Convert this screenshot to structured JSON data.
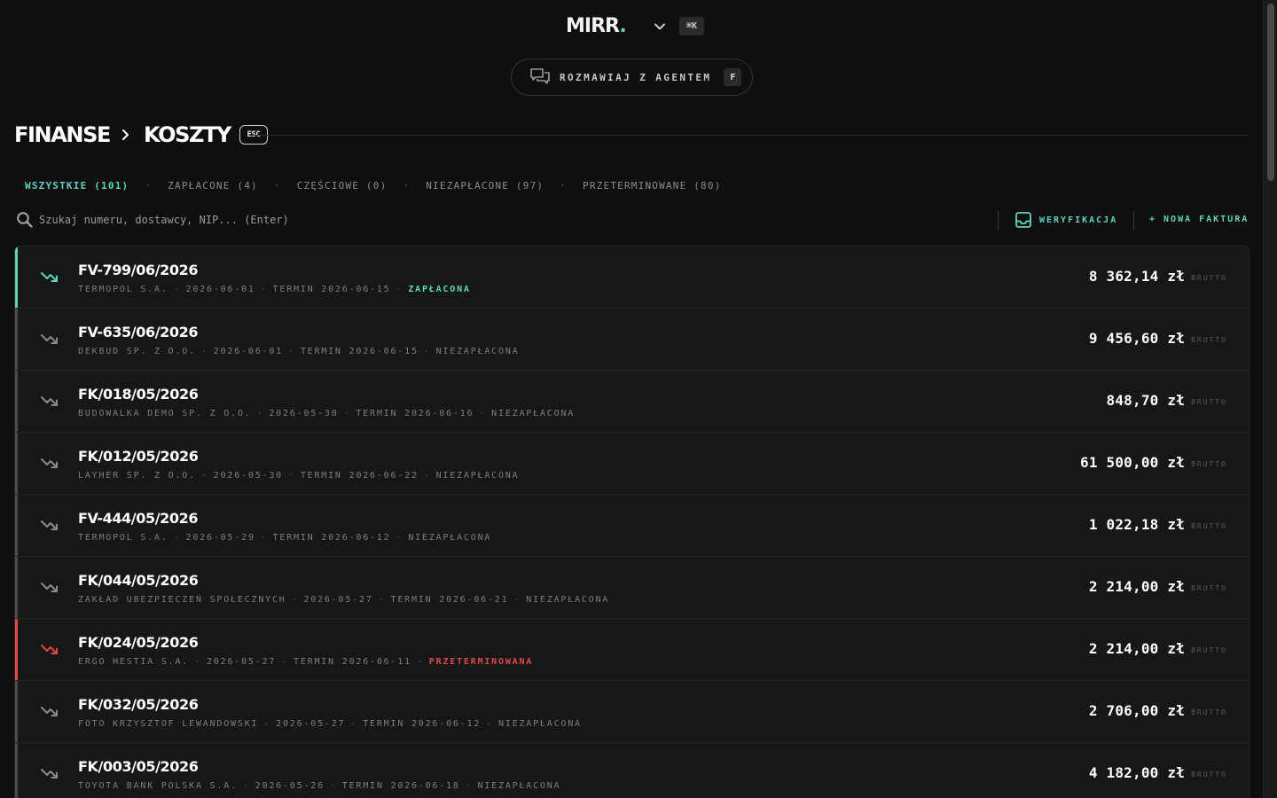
{
  "header": {
    "logo": "MIRR",
    "logo_dot": ".",
    "shortcut": "⌘K",
    "agent_label": "ROZMAWIAJ Z AGENTEM",
    "agent_shortcut": "F"
  },
  "breadcrumb": {
    "parent": "FINANSE",
    "current": "KOSZTY",
    "esc": "ESC"
  },
  "tabs": [
    {
      "label": "WSZYSTKIE (101)",
      "active": true
    },
    {
      "label": "ZAPŁACONE (4)"
    },
    {
      "label": "CZĘŚCIOWE (0)"
    },
    {
      "label": "NIEZAPŁACONE (97)"
    },
    {
      "label": "PRZETERMINOWANE (80)"
    }
  ],
  "tab_sep": "·",
  "toolbar": {
    "search_placeholder": "Szukaj numeru, dostawcy, NIP... (Enter)",
    "verify_label": "WERYFIKACJA",
    "new_invoice_label": "+ NOWA FAKTURA"
  },
  "colors": {
    "accent": "#5fd3bc",
    "overdue": "#e0484c",
    "neutral": "#4a4a4a"
  },
  "invoices": [
    {
      "number": "FV-799/06/2026",
      "supplier": "TERMOPOL S.A.",
      "date": "2026-06-01",
      "due": "TERMIN 2026-06-15",
      "status": "ZAPŁACONA",
      "kind": "paid",
      "amount": "8 362,14 zł",
      "brutto": "BRUTTO"
    },
    {
      "number": "FV-635/06/2026",
      "supplier": "DEKBUD SP. Z O.O.",
      "date": "2026-06-01",
      "due": "TERMIN 2026-06-15",
      "status": "NIEZAPŁACONA",
      "kind": "unpaid",
      "amount": "9 456,60 zł",
      "brutto": "BRUTTO"
    },
    {
      "number": "FK/018/05/2026",
      "supplier": "BUDOWALKA DEMO SP. Z O.O.",
      "date": "2026-05-30",
      "due": "TERMIN 2026-06-16",
      "status": "NIEZAPŁACONA",
      "kind": "unpaid",
      "amount": "848,70 zł",
      "brutto": "BRUTTO"
    },
    {
      "number": "FK/012/05/2026",
      "supplier": "LAYHER SP. Z O.O.",
      "date": "2026-05-30",
      "due": "TERMIN 2026-06-22",
      "status": "NIEZAPŁACONA",
      "kind": "unpaid",
      "amount": "61 500,00 zł",
      "brutto": "BRUTTO"
    },
    {
      "number": "FV-444/05/2026",
      "supplier": "TERMOPOL S.A.",
      "date": "2026-05-29",
      "due": "TERMIN 2026-06-12",
      "status": "NIEZAPŁACONA",
      "kind": "unpaid",
      "amount": "1 022,18 zł",
      "brutto": "BRUTTO"
    },
    {
      "number": "FK/044/05/2026",
      "supplier": "ZAKŁAD UBEZPIECZEŃ SPOŁECZNYCH",
      "date": "2026-05-27",
      "due": "TERMIN 2026-06-21",
      "status": "NIEZAPŁACONA",
      "kind": "unpaid",
      "amount": "2 214,00 zł",
      "brutto": "BRUTTO"
    },
    {
      "number": "FK/024/05/2026",
      "supplier": "ERGO HESTIA S.A.",
      "date": "2026-05-27",
      "due": "TERMIN 2026-06-11",
      "status": "PRZETERMINOWANA",
      "kind": "overdue",
      "amount": "2 214,00 zł",
      "brutto": "BRUTTO"
    },
    {
      "number": "FK/032/05/2026",
      "supplier": "FOTO KRZYSZTOF LEWANDOWSKI",
      "date": "2026-05-27",
      "due": "TERMIN 2026-06-12",
      "status": "NIEZAPŁACONA",
      "kind": "unpaid",
      "amount": "2 706,00 zł",
      "brutto": "BRUTTO"
    },
    {
      "number": "FK/003/05/2026",
      "supplier": "TOYOTA BANK POLSKA S.A.",
      "date": "2026-05-26",
      "due": "TERMIN 2026-06-18",
      "status": "NIEZAPŁACONA",
      "kind": "unpaid",
      "amount": "4 182,00 zł",
      "brutto": "BRUTTO"
    }
  ]
}
